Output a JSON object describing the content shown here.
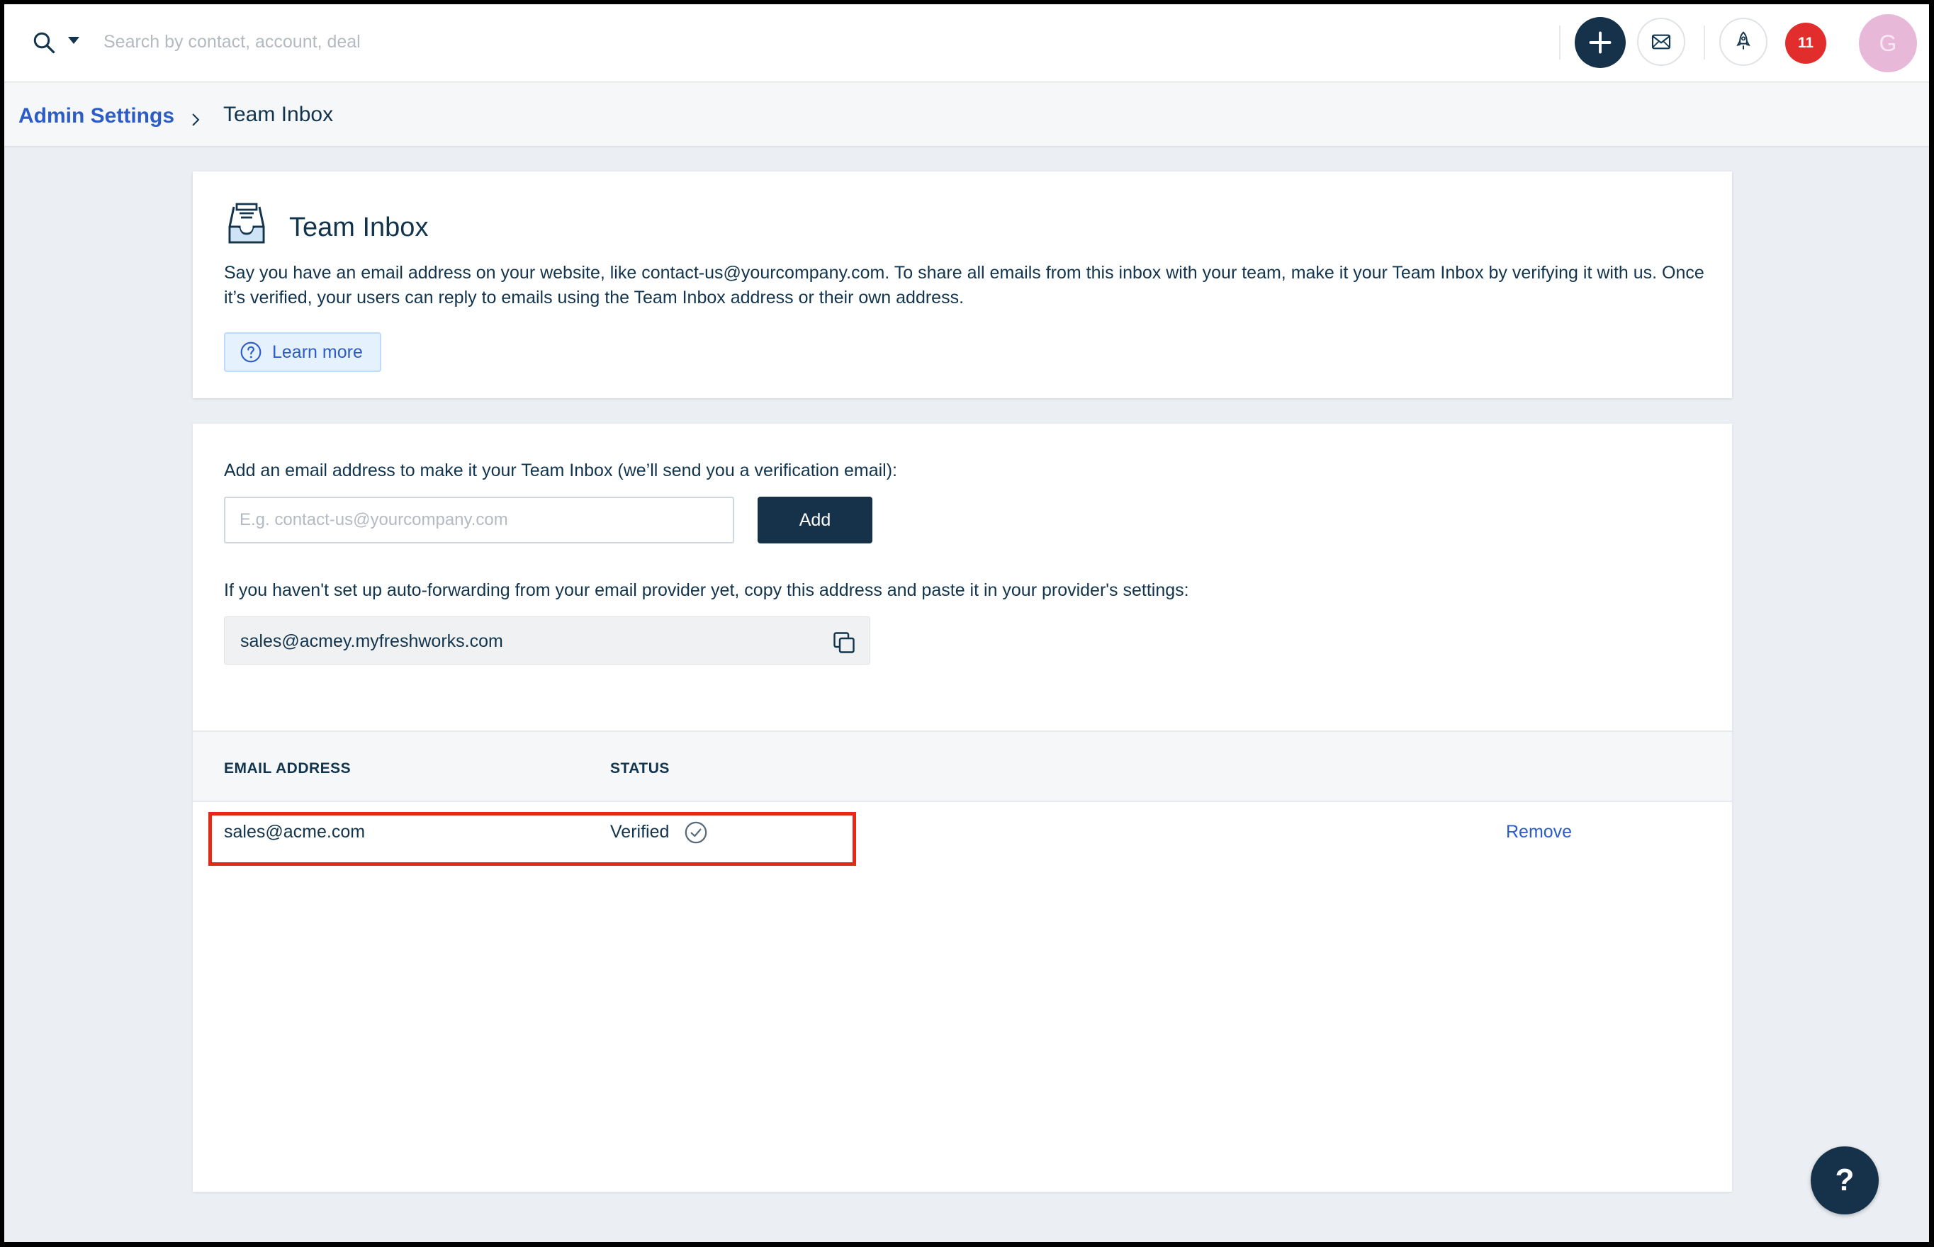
{
  "topbar": {
    "search_placeholder": "Search by contact, account, deal",
    "notification_count": "11",
    "avatar_initial": "G",
    "icons": [
      "search-icon",
      "chevron-down-icon",
      "plus-icon",
      "mail-icon",
      "rocket-icon"
    ]
  },
  "breadcrumb": {
    "parent": "Admin Settings",
    "current": "Team Inbox"
  },
  "intro": {
    "title": "Team Inbox",
    "description": "Say you have an email address on your website, like contact-us@yourcompany.com. To share all emails from this inbox with your team, make it your Team Inbox by verifying it with us. Once it’s verified, your users can reply to emails using the Team Inbox address or their own address.",
    "learn_more": "Learn more"
  },
  "add_section": {
    "label": "Add an email address to make it your Team Inbox (we’ll send you a verification email):",
    "input_placeholder": "E.g. contact-us@yourcompany.com",
    "add_button": "Add",
    "forward_label": "If you haven't set up auto-forwarding from your email provider yet, copy this address and paste it in your provider's settings:",
    "forward_address": "sales@acmey.myfreshworks.com"
  },
  "table": {
    "columns": [
      "EMAIL ADDRESS",
      "STATUS"
    ],
    "rows": [
      {
        "email": "sales@acme.com",
        "status": "Verified",
        "action": "Remove"
      }
    ]
  },
  "help_button": "?",
  "colors": {
    "primary_dark": "#15324a",
    "link_blue": "#2c5cc5",
    "badge_red": "#e22d2d",
    "highlight_red": "#e42a17"
  }
}
